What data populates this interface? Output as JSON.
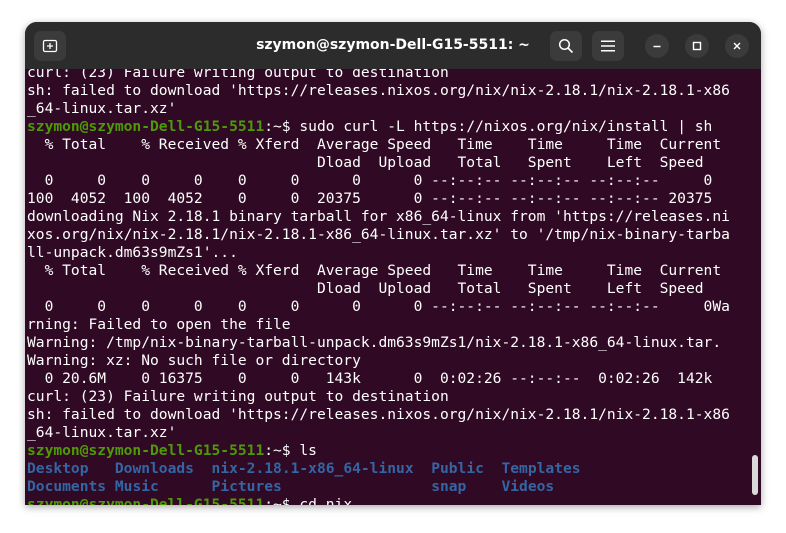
{
  "window": {
    "title": "szymon@szymon-Dell-G15-5511: ~",
    "icons": {
      "new_tab": "new-tab-icon",
      "search": "search-icon",
      "menu": "hamburger-menu-icon",
      "minimize": "minimize-icon",
      "maximize": "maximize-icon",
      "close": "close-icon"
    }
  },
  "colors": {
    "terminal_bg": "#300a24",
    "titlebar_bg": "#2c2c2c",
    "prompt": "#4e9a06",
    "directory": "#3465a4",
    "text": "#ffffff"
  },
  "terminal": {
    "lines": [
      {
        "text": "curl: (23) Failure writing output to destination"
      },
      {
        "text": "sh: failed to download 'https://releases.nixos.org/nix/nix-2.18.1/nix-2.18.1-x86"
      },
      {
        "text": "_64-linux.tar.xz'"
      },
      {
        "prompt": "szymon@szymon-Dell-G15-5511",
        "sep": ":~$ ",
        "cmd": "sudo curl -L https://nixos.org/nix/install | sh"
      },
      {
        "text": "  % Total    % Received % Xferd  Average Speed   Time    Time     Time  Current"
      },
      {
        "text": "                                 Dload  Upload   Total   Spent    Left  Speed"
      },
      {
        "text": "  0     0    0     0    0     0      0      0 --:--:-- --:--:-- --:--:--     0"
      },
      {
        "text": "100  4052  100  4052    0     0  20375      0 --:--:-- --:--:-- --:--:-- 20375"
      },
      {
        "text": "downloading Nix 2.18.1 binary tarball for x86_64-linux from 'https://releases.ni"
      },
      {
        "text": "xos.org/nix/nix-2.18.1/nix-2.18.1-x86_64-linux.tar.xz' to '/tmp/nix-binary-tarba"
      },
      {
        "text": "ll-unpack.dm63s9mZs1'..."
      },
      {
        "text": "  % Total    % Received % Xferd  Average Speed   Time    Time     Time  Current"
      },
      {
        "text": "                                 Dload  Upload   Total   Spent    Left  Speed"
      },
      {
        "text": "  0     0    0     0    0     0      0      0 --:--:-- --:--:-- --:--:--     0Wa"
      },
      {
        "text": "rning: Failed to open the file"
      },
      {
        "text": "Warning: /tmp/nix-binary-tarball-unpack.dm63s9mZs1/nix-2.18.1-x86_64-linux.tar."
      },
      {
        "text": "Warning: xz: No such file or directory"
      },
      {
        "text": "  0 20.6M    0 16375    0     0   143k      0  0:02:26 --:--:--  0:02:26  142k"
      },
      {
        "text": "curl: (23) Failure writing output to destination"
      },
      {
        "text": "sh: failed to download 'https://releases.nixos.org/nix/nix-2.18.1/nix-2.18.1-x86"
      },
      {
        "text": "_64-linux.tar.xz'"
      },
      {
        "prompt": "szymon@szymon-Dell-G15-5511",
        "sep": ":~$ ",
        "cmd": "ls"
      },
      {
        "dirs": [
          "Desktop   ",
          "Downloads  ",
          "nix-2.18.1-x86_64-linux  ",
          "Public  ",
          "Templates"
        ]
      },
      {
        "dirs": [
          "Documents ",
          "Music      ",
          "Pictures                 ",
          "snap    ",
          "Videos"
        ]
      },
      {
        "prompt": "szymon@szymon-Dell-G15-5511",
        "sep": ":~$ ",
        "cmd": "cd nix"
      }
    ]
  }
}
